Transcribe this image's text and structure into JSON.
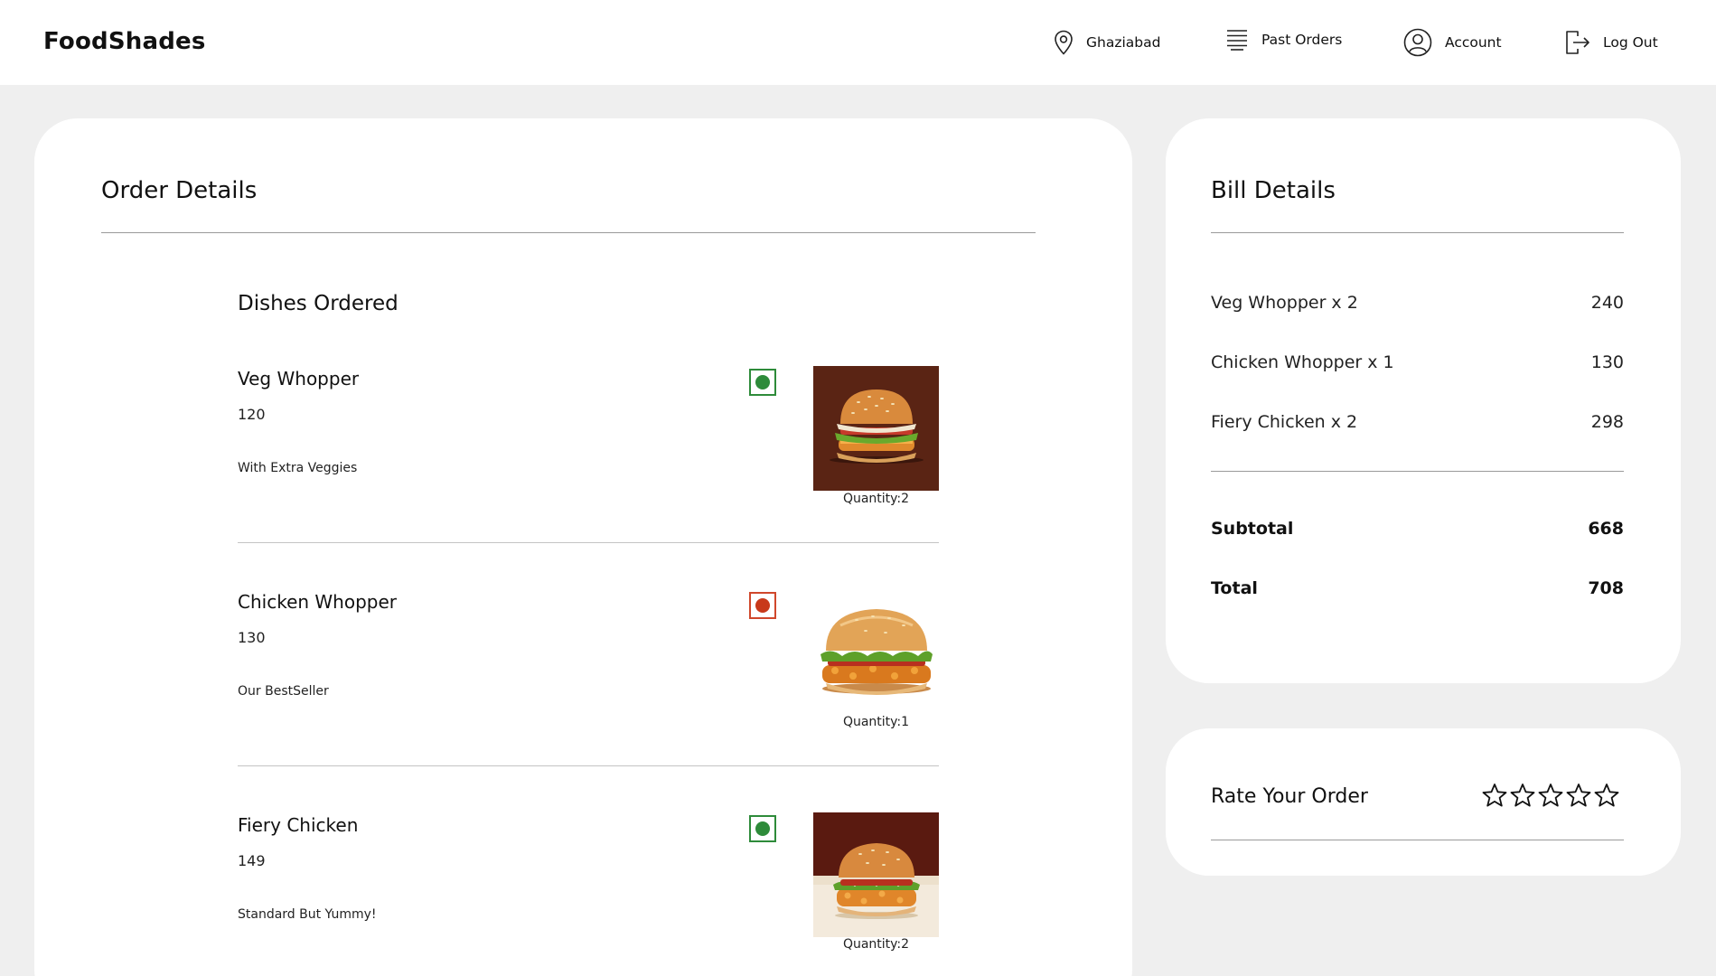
{
  "header": {
    "brand": "FoodShades",
    "nav": {
      "location": "Ghaziabad",
      "past_orders": "Past Orders",
      "account": "Account",
      "logout": "Log Out"
    }
  },
  "order": {
    "title": "Order Details",
    "section_title": "Dishes Ordered",
    "dishes": [
      {
        "name": "Veg Whopper",
        "price": "120",
        "note": "With Extra Veggies",
        "quantity": "Quantity:2",
        "diet": "veg",
        "image_icon": "veg-whopper-burger"
      },
      {
        "name": "Chicken Whopper",
        "price": "130",
        "note": "Our BestSeller",
        "quantity": "Quantity:1",
        "diet": "non-veg",
        "image_icon": "chicken-whopper-burger"
      },
      {
        "name": "Fiery Chicken",
        "price": "149",
        "note": "Standard But Yummy!",
        "quantity": "Quantity:2",
        "diet": "veg",
        "image_icon": "fiery-chicken-burger"
      }
    ]
  },
  "bill": {
    "title": "Bill Details",
    "items": [
      {
        "label": "Veg Whopper x 2",
        "amount": "240"
      },
      {
        "label": "Chicken Whopper x 1",
        "amount": "130"
      },
      {
        "label": "Fiery Chicken x 2",
        "amount": "298"
      }
    ],
    "subtotal_label": "Subtotal",
    "subtotal": "668",
    "total_label": "Total",
    "total": "708"
  },
  "rating": {
    "title": "Rate Your Order",
    "value": 0,
    "max": 5
  },
  "colors": {
    "veg": "#2e8b3a",
    "non_veg": "#c8391a",
    "page_bg": "#efefef",
    "card_bg": "#ffffff"
  }
}
